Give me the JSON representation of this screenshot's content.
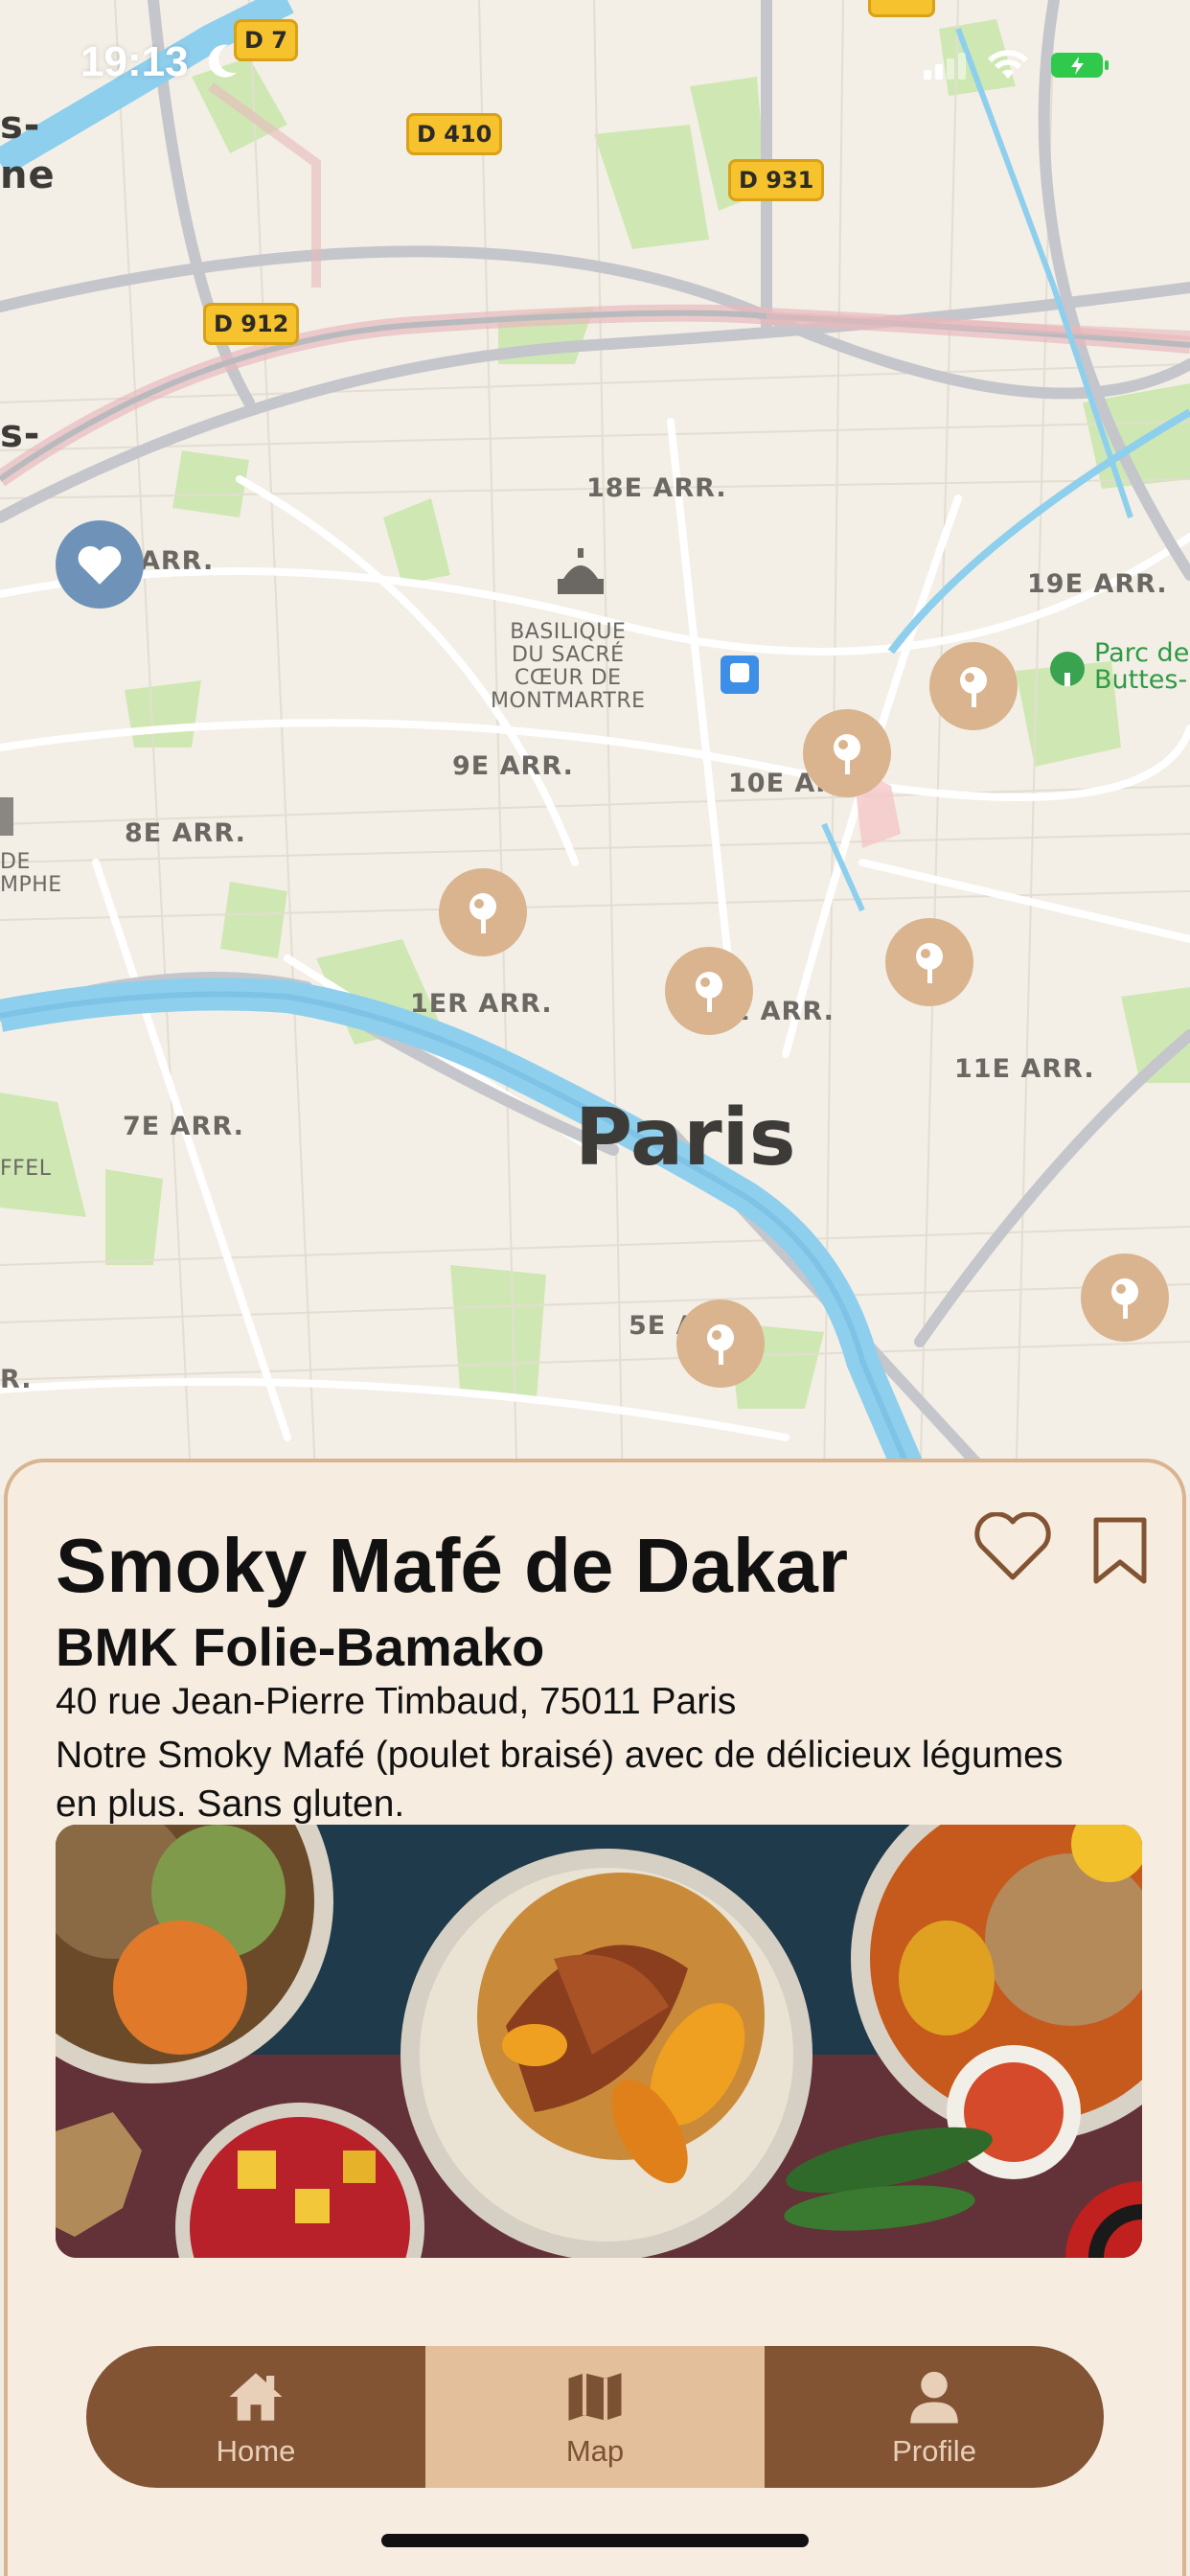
{
  "status_bar": {
    "time": "19:13"
  },
  "map": {
    "city_label": "Paris",
    "district_labels": [
      "18E ARR.",
      "19E ARR.",
      "9E ARR.",
      "10E ARR.",
      "8E ARR.",
      "1ER ARR.",
      "2E ARR.",
      "11E ARR.",
      "7E ARR.",
      "5E ARR.",
      "ARR."
    ],
    "road_badges": [
      "D 7",
      "D 410",
      "D 931",
      "D 912"
    ],
    "poi_basilique": "BASILIQUE\nDU SACRÉ\nCŒUR DE\nMONTMARTRE",
    "park_label": "Parc des\nButtes-",
    "edge_fragments": [
      "s-",
      "ne",
      "s-",
      "DE\nMPHE",
      "FFEL",
      "R."
    ],
    "pins": [
      {
        "name": "restaurant-pin"
      },
      {
        "name": "restaurant-pin"
      },
      {
        "name": "restaurant-pin"
      },
      {
        "name": "restaurant-pin"
      },
      {
        "name": "restaurant-pin"
      },
      {
        "name": "restaurant-pin"
      },
      {
        "name": "restaurant-pin"
      }
    ],
    "favorite_pin": "heart-icon"
  },
  "card": {
    "dish_title": "Smoky Mafé de Dakar",
    "restaurant": "BMK Folie-Bamako",
    "address": "40 rue Jean-Pierre Timbaud, 75011 Paris",
    "description": "Notre Smoky Mafé (poulet braisé) avec de délicieux légumes en plus. Sans gluten."
  },
  "tabs": [
    {
      "label": "Home",
      "icon": "home-icon",
      "active": false
    },
    {
      "label": "Map",
      "icon": "map-icon",
      "active": true
    },
    {
      "label": "Profile",
      "icon": "profile-icon",
      "active": false
    }
  ],
  "colors": {
    "accent": "#825434",
    "accent_light": "#e3bf9c",
    "pin": "#d9b48e",
    "favorite_pin": "#6f93b8",
    "card_bg": "#f6ece0"
  }
}
